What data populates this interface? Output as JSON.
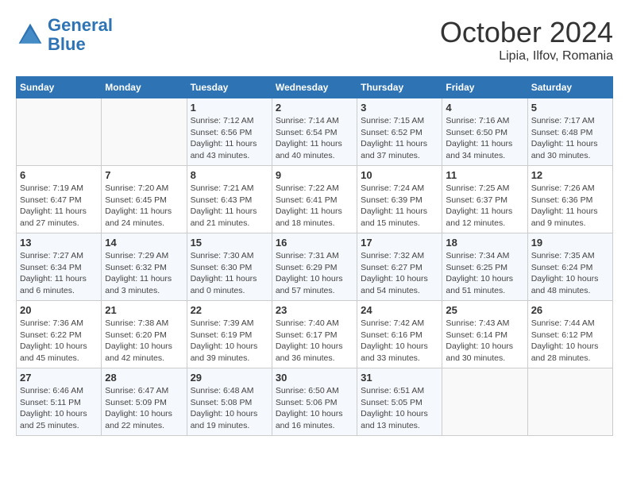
{
  "header": {
    "logo_line1": "General",
    "logo_line2": "Blue",
    "month": "October 2024",
    "location": "Lipia, Ilfov, Romania"
  },
  "weekdays": [
    "Sunday",
    "Monday",
    "Tuesday",
    "Wednesday",
    "Thursday",
    "Friday",
    "Saturday"
  ],
  "weeks": [
    [
      {
        "day": "",
        "info": ""
      },
      {
        "day": "",
        "info": ""
      },
      {
        "day": "1",
        "info": "Sunrise: 7:12 AM\nSunset: 6:56 PM\nDaylight: 11 hours and 43 minutes."
      },
      {
        "day": "2",
        "info": "Sunrise: 7:14 AM\nSunset: 6:54 PM\nDaylight: 11 hours and 40 minutes."
      },
      {
        "day": "3",
        "info": "Sunrise: 7:15 AM\nSunset: 6:52 PM\nDaylight: 11 hours and 37 minutes."
      },
      {
        "day": "4",
        "info": "Sunrise: 7:16 AM\nSunset: 6:50 PM\nDaylight: 11 hours and 34 minutes."
      },
      {
        "day": "5",
        "info": "Sunrise: 7:17 AM\nSunset: 6:48 PM\nDaylight: 11 hours and 30 minutes."
      }
    ],
    [
      {
        "day": "6",
        "info": "Sunrise: 7:19 AM\nSunset: 6:47 PM\nDaylight: 11 hours and 27 minutes."
      },
      {
        "day": "7",
        "info": "Sunrise: 7:20 AM\nSunset: 6:45 PM\nDaylight: 11 hours and 24 minutes."
      },
      {
        "day": "8",
        "info": "Sunrise: 7:21 AM\nSunset: 6:43 PM\nDaylight: 11 hours and 21 minutes."
      },
      {
        "day": "9",
        "info": "Sunrise: 7:22 AM\nSunset: 6:41 PM\nDaylight: 11 hours and 18 minutes."
      },
      {
        "day": "10",
        "info": "Sunrise: 7:24 AM\nSunset: 6:39 PM\nDaylight: 11 hours and 15 minutes."
      },
      {
        "day": "11",
        "info": "Sunrise: 7:25 AM\nSunset: 6:37 PM\nDaylight: 11 hours and 12 minutes."
      },
      {
        "day": "12",
        "info": "Sunrise: 7:26 AM\nSunset: 6:36 PM\nDaylight: 11 hours and 9 minutes."
      }
    ],
    [
      {
        "day": "13",
        "info": "Sunrise: 7:27 AM\nSunset: 6:34 PM\nDaylight: 11 hours and 6 minutes."
      },
      {
        "day": "14",
        "info": "Sunrise: 7:29 AM\nSunset: 6:32 PM\nDaylight: 11 hours and 3 minutes."
      },
      {
        "day": "15",
        "info": "Sunrise: 7:30 AM\nSunset: 6:30 PM\nDaylight: 11 hours and 0 minutes."
      },
      {
        "day": "16",
        "info": "Sunrise: 7:31 AM\nSunset: 6:29 PM\nDaylight: 10 hours and 57 minutes."
      },
      {
        "day": "17",
        "info": "Sunrise: 7:32 AM\nSunset: 6:27 PM\nDaylight: 10 hours and 54 minutes."
      },
      {
        "day": "18",
        "info": "Sunrise: 7:34 AM\nSunset: 6:25 PM\nDaylight: 10 hours and 51 minutes."
      },
      {
        "day": "19",
        "info": "Sunrise: 7:35 AM\nSunset: 6:24 PM\nDaylight: 10 hours and 48 minutes."
      }
    ],
    [
      {
        "day": "20",
        "info": "Sunrise: 7:36 AM\nSunset: 6:22 PM\nDaylight: 10 hours and 45 minutes."
      },
      {
        "day": "21",
        "info": "Sunrise: 7:38 AM\nSunset: 6:20 PM\nDaylight: 10 hours and 42 minutes."
      },
      {
        "day": "22",
        "info": "Sunrise: 7:39 AM\nSunset: 6:19 PM\nDaylight: 10 hours and 39 minutes."
      },
      {
        "day": "23",
        "info": "Sunrise: 7:40 AM\nSunset: 6:17 PM\nDaylight: 10 hours and 36 minutes."
      },
      {
        "day": "24",
        "info": "Sunrise: 7:42 AM\nSunset: 6:16 PM\nDaylight: 10 hours and 33 minutes."
      },
      {
        "day": "25",
        "info": "Sunrise: 7:43 AM\nSunset: 6:14 PM\nDaylight: 10 hours and 30 minutes."
      },
      {
        "day": "26",
        "info": "Sunrise: 7:44 AM\nSunset: 6:12 PM\nDaylight: 10 hours and 28 minutes."
      }
    ],
    [
      {
        "day": "27",
        "info": "Sunrise: 6:46 AM\nSunset: 5:11 PM\nDaylight: 10 hours and 25 minutes."
      },
      {
        "day": "28",
        "info": "Sunrise: 6:47 AM\nSunset: 5:09 PM\nDaylight: 10 hours and 22 minutes."
      },
      {
        "day": "29",
        "info": "Sunrise: 6:48 AM\nSunset: 5:08 PM\nDaylight: 10 hours and 19 minutes."
      },
      {
        "day": "30",
        "info": "Sunrise: 6:50 AM\nSunset: 5:06 PM\nDaylight: 10 hours and 16 minutes."
      },
      {
        "day": "31",
        "info": "Sunrise: 6:51 AM\nSunset: 5:05 PM\nDaylight: 10 hours and 13 minutes."
      },
      {
        "day": "",
        "info": ""
      },
      {
        "day": "",
        "info": ""
      }
    ]
  ]
}
